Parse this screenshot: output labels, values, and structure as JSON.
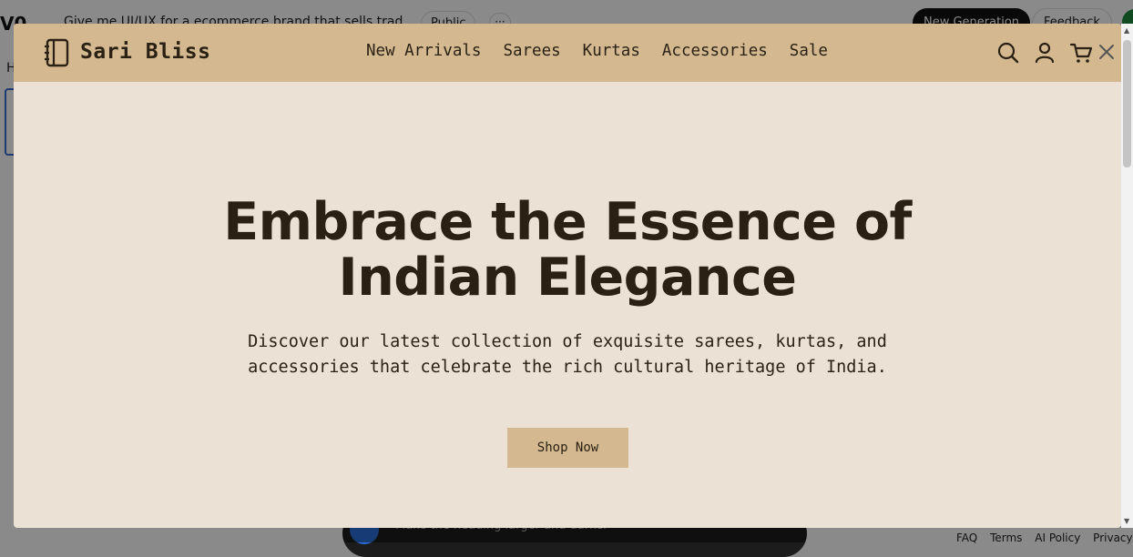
{
  "background": {
    "logo": "V0",
    "prompt": "Give me UI/UX for a ecommerce brand that sells traditio",
    "visibility_label": "Public",
    "more_label": "···",
    "new_generation_label": "New Generation",
    "feedback_label": "Feedback",
    "side_label": "H",
    "chat_placeholder": "Make the heading larger and darker",
    "footer_links": [
      "FAQ",
      "Terms",
      "AI Policy",
      "Privacy"
    ]
  },
  "modal": {
    "brand": "Sari Bliss",
    "nav": [
      "New Arrivals",
      "Sarees",
      "Kurtas",
      "Accessories",
      "Sale"
    ],
    "icons": [
      "search-icon",
      "user-icon",
      "cart-icon",
      "close-icon"
    ],
    "hero": {
      "title_line1": "Embrace the Essence of",
      "title_line2": "Indian Elegance",
      "subtitle": "Discover our latest collection of exquisite sarees, kurtas, and accessories that celebrate the rich cultural heritage of India.",
      "cta": "Shop Now"
    }
  },
  "colors": {
    "navbar": "#d4b890",
    "hero_bg": "#ebe2d5",
    "text": "#2a2114",
    "cta_bg": "#d4b890"
  }
}
